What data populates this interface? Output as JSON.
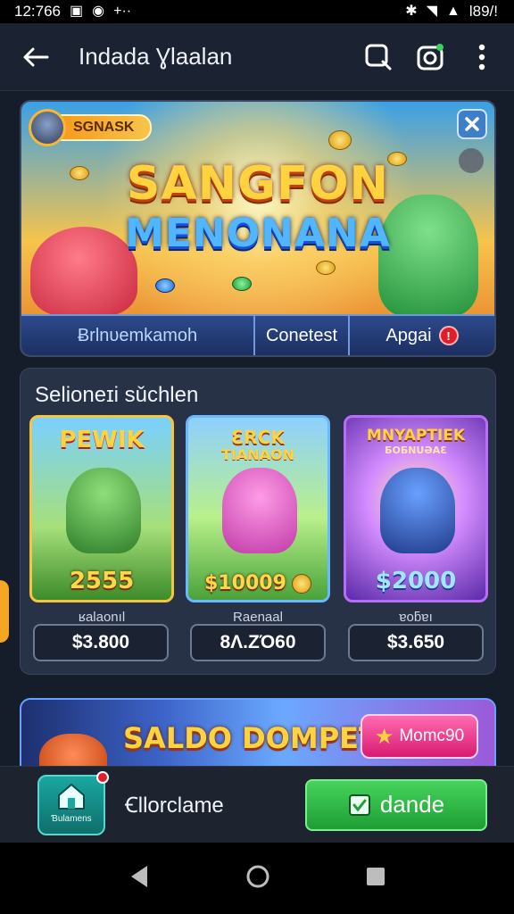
{
  "status_bar": {
    "time": "12:766",
    "battery": "Ɩ89/!"
  },
  "app_bar": {
    "title": "Indada Ɣlaalan"
  },
  "hero": {
    "badge": "SGNASK",
    "title_line1": "SANGFON",
    "title_line2": "MENONANA",
    "tabs": [
      {
        "label": "Ƀrlnυemkamoh"
      },
      {
        "label": "Conetest"
      },
      {
        "label": "Apgai",
        "badge": "!"
      }
    ]
  },
  "selection": {
    "title": "Selioneɪi sǔchlen",
    "cards": [
      {
        "title": "PEWIK",
        "subtitle": "",
        "amount": "2555",
        "label": "ʁalaonıl",
        "price": "$3.800"
      },
      {
        "title": "ƐRCK",
        "subtitle": "TIANAON",
        "amount": "$10009",
        "label": "Raenaal",
        "price": "8Ʌ.ZΌ60"
      },
      {
        "title": "MNYAPTIEK",
        "subtitle": "ƂOƂNUƏAƐ",
        "amount": "$2000",
        "label": "ɐoƃɐı",
        "price": "$3.650"
      }
    ]
  },
  "promo": {
    "title": "SALDO DOMPET",
    "button_label": "Momc90"
  },
  "bottom_bar": {
    "home_label": "Ɓulamens",
    "middle_label": "Ꞓllorclame",
    "action_label": "dande"
  },
  "colors": {
    "background": "#151c2a",
    "accent_gold": "#ffd23f",
    "action_green": "#1e9e34",
    "promo_pink": "#d81b72"
  },
  "icons": [
    "back-arrow-icon",
    "search-icon",
    "camera-icon",
    "more-vert-icon",
    "close-icon",
    "home-icon",
    "checkbox-icon",
    "star-icon"
  ]
}
